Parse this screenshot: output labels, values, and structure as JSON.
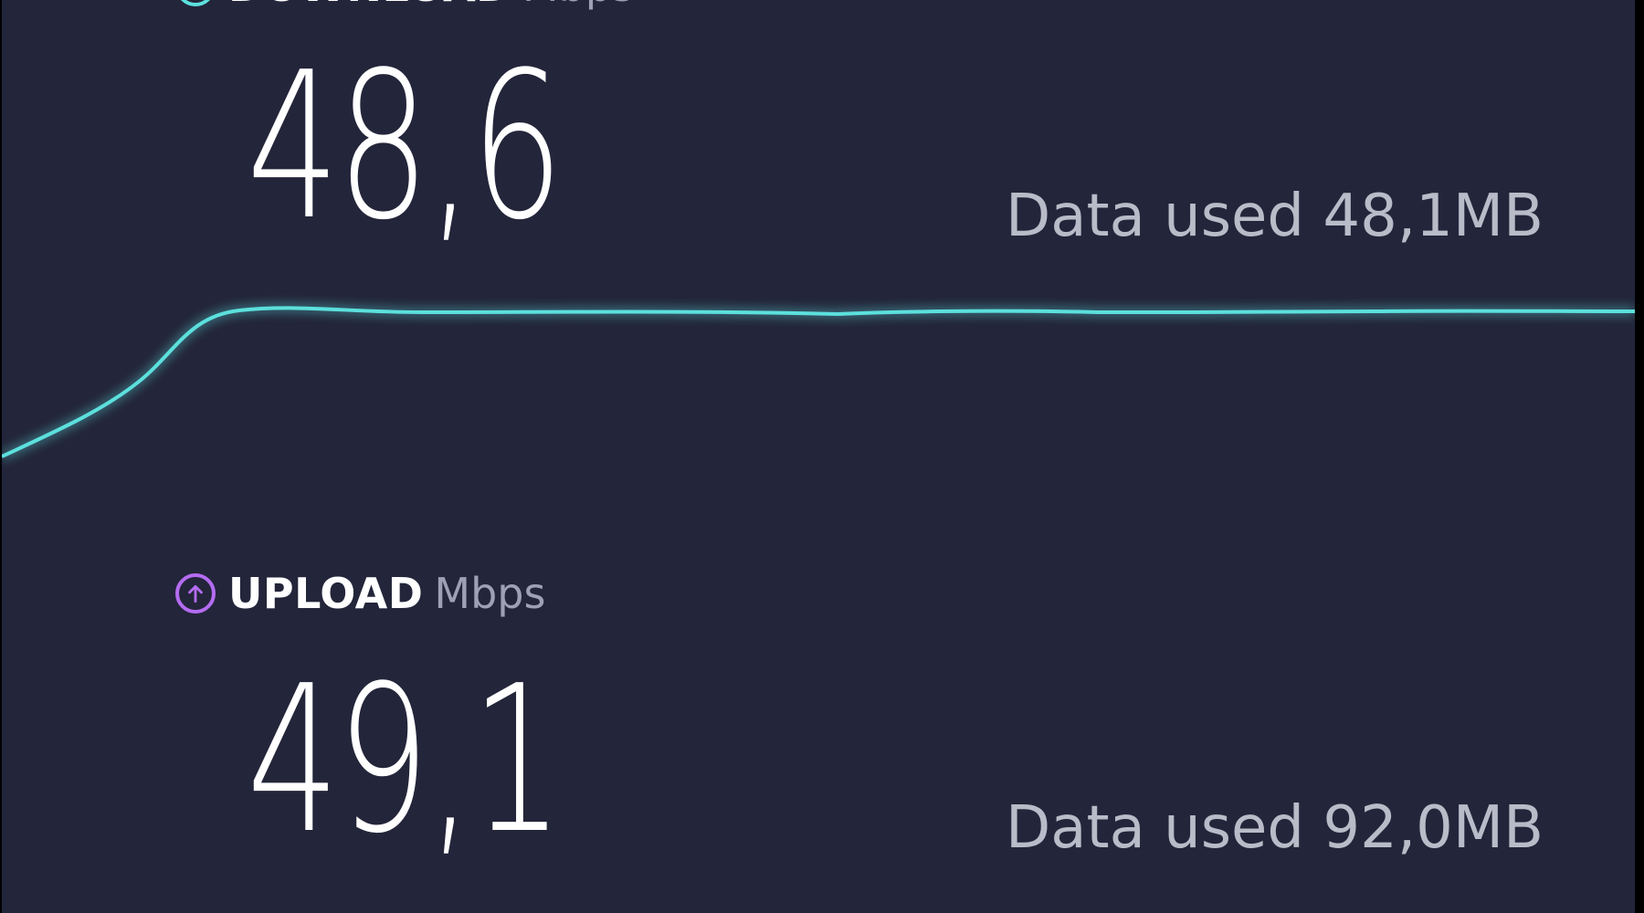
{
  "download": {
    "label": "DOWNLOAD",
    "unit": "Mbps",
    "value": "48,6",
    "data_used": "Data used 48,1MB",
    "icon": "arrow-down-circle-icon",
    "color": "#5ce0dd"
  },
  "upload": {
    "label": "UPLOAD",
    "unit": "Mbps",
    "value": "49,1",
    "data_used": "Data used 92,0MB",
    "icon": "arrow-up-circle-icon",
    "color": "#b46cf1"
  },
  "colors": {
    "background": "#23253a",
    "graph_line": "#5ce0dd",
    "text_primary": "#ffffff",
    "text_secondary": "#b9bbc8"
  }
}
